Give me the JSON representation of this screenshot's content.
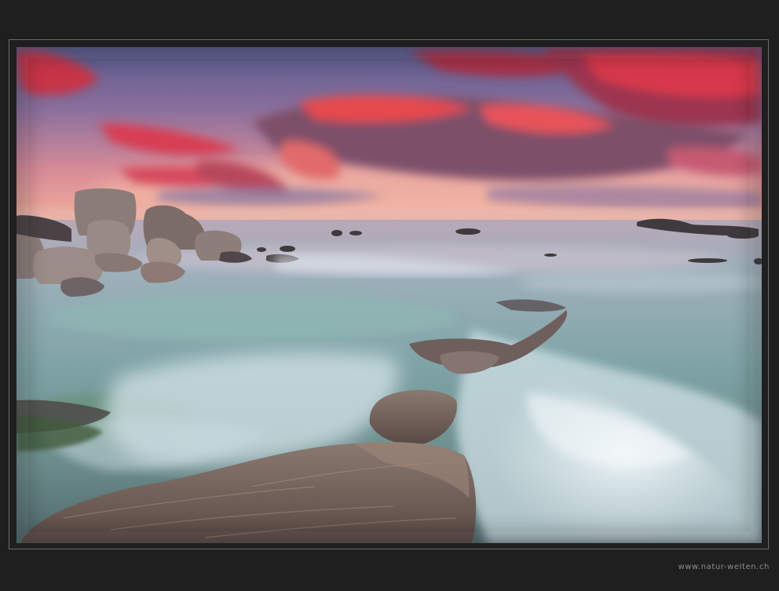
{
  "photo": {
    "subject": "long-exposure seascape at sunset with granite boulders and flowing surf",
    "colors": {
      "border": "#1f1f1f",
      "frame_line": "#6a6a6a",
      "sky_top": "#5c5f8d",
      "sky_horizon": "#f0a08c",
      "clouds": "#e8465a",
      "sea": "#8fa9b0",
      "surf": "#e6eef2",
      "rock": "#6d5e58"
    }
  },
  "watermark": {
    "text": "www.natur-welten.ch"
  }
}
